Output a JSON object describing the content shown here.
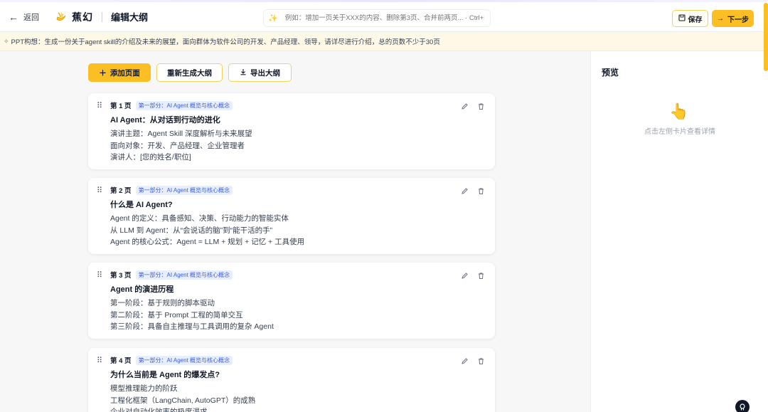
{
  "header": {
    "back_label": "返回",
    "brand": "蕉幻",
    "page_title": "编辑大纲",
    "ai_placeholder": "例如：增加一页关于XXX的内容、删除第3页、合并前两页... · Ctrl+Enter",
    "save_label": "保存",
    "next_label": "下一步"
  },
  "idea": {
    "text": "PPT构想：生成一份关于agent skill的介绍及未来的展望，面向群体为软件公司的开发、产品经理、领导，请详尽进行介绍，总的页数不少于30页"
  },
  "toolbar": {
    "add_label": "添加页面",
    "regen_label": "重新生成大纲",
    "export_label": "导出大纲"
  },
  "cards": [
    {
      "page": "第 1 页",
      "tag": "第一部分：AI Agent 概览与核心概念",
      "title": "AI Agent：从对话到行动的进化",
      "bullets": [
        "演讲主题：Agent Skill 深度解析与未来展望",
        "面向对象：开发、产品经理、企业管理者",
        "演讲人：[您的姓名/职位]"
      ]
    },
    {
      "page": "第 2 页",
      "tag": "第一部分：AI Agent 概览与核心概念",
      "title": "什么是 AI Agent?",
      "bullets": [
        "Agent 的定义：具备感知、决策、行动能力的智能实体",
        "从 LLM 到 Agent：从“会说话的脑”到“能干活的手”",
        "Agent 的核心公式：Agent = LLM + 规划 + 记忆 + 工具使用"
      ]
    },
    {
      "page": "第 3 页",
      "tag": "第一部分：AI Agent 概览与核心概念",
      "title": "Agent 的演进历程",
      "bullets": [
        "第一阶段：基于规则的脚本驱动",
        "第二阶段：基于 Prompt 工程的简单交互",
        "第三阶段：具备自主推理与工具调用的复杂 Agent"
      ]
    },
    {
      "page": "第 4 页",
      "tag": "第一部分：AI Agent 概览与核心概念",
      "title": "为什么当前是 Agent 的爆发点?",
      "bullets": [
        "模型推理能力的阶跃",
        "工程化框架（LangChain, AutoGPT）的成熟",
        "企业对自动化效率的极度渴求"
      ]
    }
  ],
  "preview": {
    "title": "预览",
    "hint": "点击左侧卡片查看详情"
  },
  "colors": {
    "accent": "#fbbf24",
    "tag_bg": "#e7efff",
    "tag_text": "#3b5bdb"
  },
  "icons": [
    "arrow-left-icon",
    "banana-logo-icon",
    "sparkle-icon",
    "save-icon",
    "arrow-right-icon",
    "lightbulb-icon",
    "plus-icon",
    "download-icon",
    "drag-handle-icon",
    "edit-icon",
    "trash-icon",
    "pointing-hand-icon",
    "github-icon"
  ]
}
